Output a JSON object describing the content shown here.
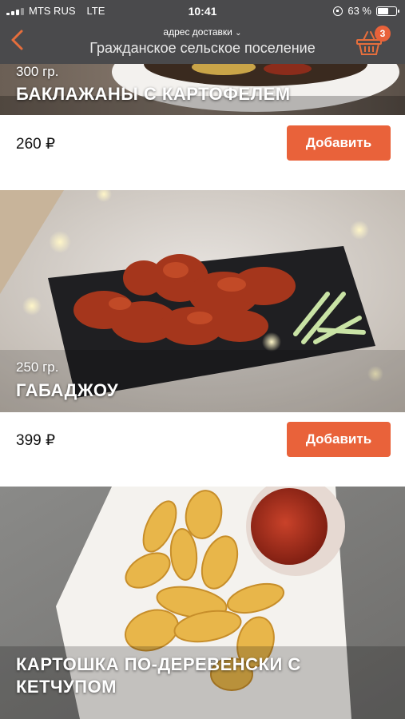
{
  "status": {
    "carrier": "MTS RUS",
    "network": "LTE",
    "time": "10:41",
    "battery": "63 %",
    "battery_level": 0.63
  },
  "header": {
    "address_label": "адрес доставки",
    "address_value": "Гражданское сельское поселение",
    "cart_count": "3",
    "accent_color": "#e9623a"
  },
  "items": [
    {
      "weight": "300 гр.",
      "title": "БАКЛАЖАНЫ С КАРТОФЕЛЕМ",
      "price": "260 ₽",
      "button": "Добавить"
    },
    {
      "weight": "250 гр.",
      "title": "ГАБАДЖОУ",
      "price": "399 ₽",
      "button": "Добавить"
    },
    {
      "title": "КАРТОШКА ПО-ДЕРЕВЕНСКИ С КЕТЧУПОМ"
    }
  ]
}
